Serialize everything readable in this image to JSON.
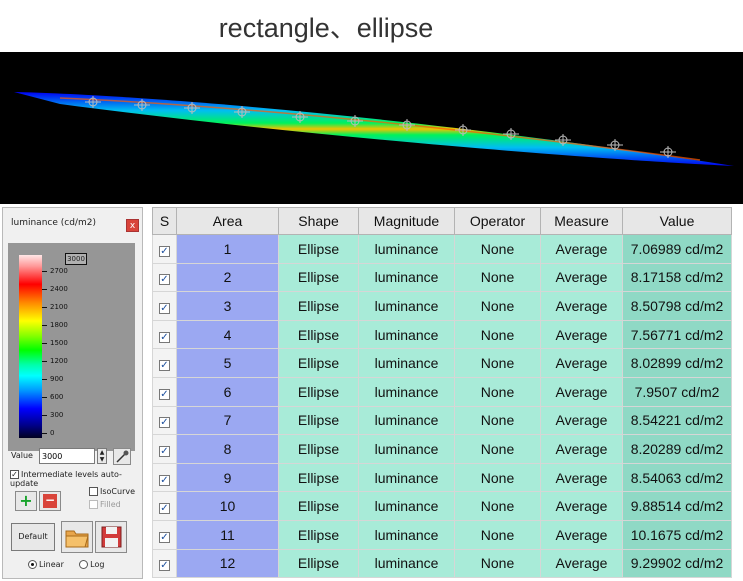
{
  "title": "rectangle、ellipse",
  "legend": {
    "title": "luminance (cd/m2)",
    "close": "x",
    "top_value": "3000",
    "ticks": [
      "2700",
      "2400",
      "2100",
      "1800",
      "1500",
      "1200",
      "900",
      "600",
      "300",
      "0"
    ],
    "value_label": "Value",
    "value_input": "3000",
    "auto_update_label": "Intermediate levels auto-update",
    "isocurve_label": "IsoCurve",
    "filled_label": "Filled",
    "default_label": "Default",
    "linear_label": "Linear",
    "log_label": "Log"
  },
  "table": {
    "headers": [
      "S",
      "Area",
      "Shape",
      "Magnitude",
      "Operator",
      "Measure",
      "Value"
    ],
    "rows": [
      [
        "1",
        "Ellipse",
        "luminance",
        "None",
        "Average",
        "7.06989 cd/m2"
      ],
      [
        "2",
        "Ellipse",
        "luminance",
        "None",
        "Average",
        "8.17158 cd/m2"
      ],
      [
        "3",
        "Ellipse",
        "luminance",
        "None",
        "Average",
        "8.50798 cd/m2"
      ],
      [
        "4",
        "Ellipse",
        "luminance",
        "None",
        "Average",
        "7.56771 cd/m2"
      ],
      [
        "5",
        "Ellipse",
        "luminance",
        "None",
        "Average",
        "8.02899 cd/m2"
      ],
      [
        "6",
        "Ellipse",
        "luminance",
        "None",
        "Average",
        "7.9507 cd/m2"
      ],
      [
        "7",
        "Ellipse",
        "luminance",
        "None",
        "Average",
        "8.54221 cd/m2"
      ],
      [
        "8",
        "Ellipse",
        "luminance",
        "None",
        "Average",
        "8.20289 cd/m2"
      ],
      [
        "9",
        "Ellipse",
        "luminance",
        "None",
        "Average",
        "8.54063 cd/m2"
      ],
      [
        "10",
        "Ellipse",
        "luminance",
        "None",
        "Average",
        "9.88514 cd/m2"
      ],
      [
        "11",
        "Ellipse",
        "luminance",
        "None",
        "Average",
        "10.1675 cd/m2"
      ],
      [
        "12",
        "Ellipse",
        "luminance",
        "None",
        "Average",
        "9.29902 cd/m2"
      ]
    ]
  }
}
